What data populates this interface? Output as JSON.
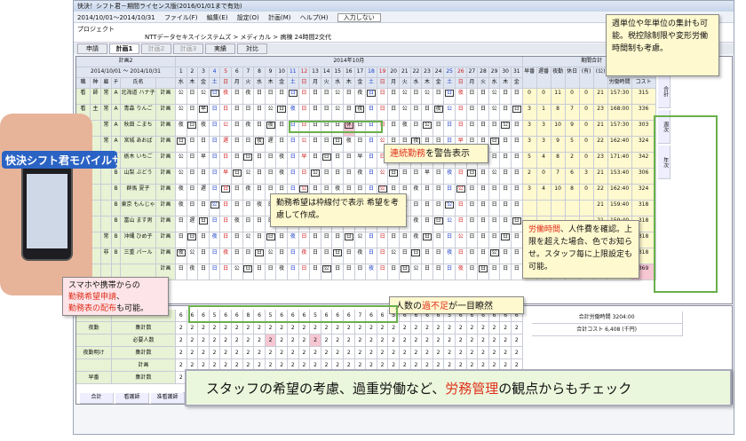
{
  "window": {
    "title": "快決！シフト君－期間ライセンス版(2016/01/01まで有効)",
    "period": "2014/10/01～2014/10/31",
    "menu": [
      "ファイル(F)",
      "編集(E)",
      "設定(O)",
      "計画(M)",
      "ヘルプ(H)"
    ],
    "input_placeholder": "入力しない",
    "project_label": "プロジェクト",
    "project_name": "NTTデータセキスイシステムズ > メディカル > 病棟 24時間2交代"
  },
  "tabs": [
    {
      "label": "申請"
    },
    {
      "label": "計画1"
    },
    {
      "label": "計画2"
    },
    {
      "label": "計画3"
    },
    {
      "label": "実績"
    },
    {
      "label": "対比"
    }
  ],
  "grid": {
    "plan_label": "計画2",
    "range": "2014/10/01 ～ 2014/10/31",
    "month": "2014年10月",
    "period_total": "期間合計",
    "head_cols": [
      "職",
      "种",
      "雇",
      "チ",
      "氏名"
    ],
    "days": [
      "1",
      "2",
      "3",
      "4",
      "5",
      "6",
      "7",
      "8",
      "9",
      "10",
      "11",
      "12",
      "13",
      "14",
      "15",
      "16",
      "17",
      "18",
      "19",
      "20",
      "21",
      "22",
      "23",
      "24",
      "25",
      "26",
      "27",
      "28",
      "29",
      "30",
      "31"
    ],
    "weekdays": [
      "水",
      "木",
      "金",
      "土",
      "日",
      "月",
      "火",
      "水",
      "木",
      "金",
      "土",
      "日",
      "月",
      "火",
      "水",
      "木",
      "金",
      "土",
      "日",
      "月",
      "火",
      "水",
      "木",
      "金",
      "土",
      "日",
      "月",
      "火",
      "水",
      "木",
      "金"
    ],
    "sum_headers": [
      "早番",
      "遅番",
      "夜勤",
      "休日",
      "(有)",
      "(公)"
    ],
    "total_headers": [
      "合計",
      "労働時間",
      "コスト"
    ],
    "side_tabs": [
      "合計",
      "週次",
      "年次"
    ],
    "staff": [
      {
        "role": "看",
        "type": "師",
        "emp": "常",
        "team": "A",
        "name": "北海道 ハナ子",
        "plan": "計画",
        "sums": [
          "0",
          "0",
          "11",
          "0",
          "0",
          "21"
        ],
        "hours": "157:30",
        "cost": "315"
      },
      {
        "role": "看",
        "type": "主",
        "emp": "常",
        "team": "A",
        "name": "青森 りんご",
        "plan": "計画",
        "sums": [
          "3",
          "1",
          "8",
          "7",
          "0",
          "23"
        ],
        "hours": "168:00",
        "cost": "336"
      },
      {
        "role": "看",
        "type": "",
        "emp": "常",
        "team": "A",
        "name": "秋田 こまち",
        "plan": "計画",
        "sums": [
          "3",
          "3",
          "10",
          "9",
          "0",
          "21"
        ],
        "hours": "157:30",
        "cost": "303"
      },
      {
        "role": "看",
        "type": "",
        "emp": "常",
        "team": "A",
        "name": "宮城 あおば",
        "plan": "計画",
        "sums": [
          "3",
          "3",
          "9",
          "5",
          "0",
          "22"
        ],
        "hours": "162:40",
        "cost": "324"
      },
      {
        "role": "",
        "type": "",
        "emp": "",
        "team": "A",
        "name": "栃木 いちご",
        "plan": "計画",
        "sums": [
          "5",
          "4",
          "8",
          "2",
          "0",
          "23"
        ],
        "hours": "171:40",
        "cost": "342"
      },
      {
        "role": "",
        "type": "",
        "emp": "",
        "team": "B",
        "name": "山梨 ぶどう",
        "plan": "計画",
        "sums": [
          "2",
          "0",
          "7",
          "6",
          "3",
          "21"
        ],
        "hours": "153:40",
        "cost": "306"
      },
      {
        "role": "",
        "type": "",
        "emp": "",
        "team": "B",
        "name": "群馬 夏子",
        "plan": "計画",
        "sums": [
          "3",
          "4",
          "10",
          "8",
          "0",
          "22"
        ],
        "hours": "162:40",
        "cost": "324"
      },
      {
        "role": "",
        "type": "",
        "emp": "",
        "team": "B",
        "name": "東京 もんじゃ",
        "plan": "計画",
        "sums": [
          "",
          "",
          "",
          "",
          "",
          "21"
        ],
        "hours": "159:40",
        "cost": "318"
      },
      {
        "role": "",
        "type": "",
        "emp": "",
        "team": "B",
        "name": "富山 ます男",
        "plan": "計画",
        "sums": [
          "",
          "",
          "",
          "",
          "",
          "21"
        ],
        "hours": "159:40",
        "cost": "318"
      },
      {
        "role": "",
        "type": "",
        "emp": "常",
        "team": "B",
        "name": "沖縄 ひめ子",
        "plan": "計画",
        "sums": [
          "",
          "",
          "",
          "",
          "",
          "21"
        ],
        "hours": "159:40",
        "cost": "318"
      },
      {
        "role": "",
        "type": "",
        "emp": "非",
        "team": "B",
        "name": "三重 パール",
        "plan": "計画",
        "sums": [
          "",
          "",
          "",
          "",
          "",
          "21"
        ],
        "hours": "159:40",
        "cost": "318"
      },
      {
        "role": "",
        "type": "",
        "emp": "",
        "team": "",
        "name": "",
        "plan": "計画",
        "sums": [
          "",
          "",
          "",
          "",
          "",
          "16"
        ],
        "hours": "124:00",
        "cost": "369"
      }
    ],
    "rows_codes": [
      "公日公日夜日夜日日日日日日日公日夜日日日公日公日日夜日日公日日",
      "公日早日日日日日公日夜日日日公日夜日日日公日日夜公日日日公日日",
      "夜日夜日公日夜日夜日日日日日日休日日日日夜日公日日日日日日公日",
      "日日日日遅日日夜遅日日公日日日夜日日公日日夜日日日早日日日日日",
      "公日早日日日日日日夜日早日日日日早日日日夜日早日日日日早日日日",
      "公日日日早日公日日夜日日公日日日夜日公日日日早日夜日日日公日日",
      "夜日遅日日日夜日日日日公日日夜日日日公日日夜日日日公日日日日日",
      "夜日日公日日日夜日日日公日日夜日日公日日夜日日日公日日日日日日",
      "日遅日日日夜日日日公日日夜日日日早日日日日夜日日公日日日日日日",
      "日日日夜日日公日日日夜日日日日日公日日日日夜日日日公日日日日日",
      "夜公日日夜日日日公日日夜日日日日夜日日公日日日日夜日日日公日日",
      "日夜日日日公日日日夜日日日公日日日夜日日日公日日日夜日日日日日"
    ]
  },
  "lower": {
    "rows": [
      {
        "label": "",
        "sub": "",
        "vals": [
          "6",
          "6",
          "6",
          "5",
          "6",
          "6",
          "8",
          "6",
          "5",
          "6",
          "6",
          "6",
          "5",
          "6",
          "6",
          "6",
          "7",
          "6",
          "6",
          "5",
          "6",
          "6",
          "6",
          "6",
          "5",
          "6",
          "6",
          "6",
          "6",
          "6",
          "6"
        ]
      },
      {
        "label": "夜勤",
        "sub": "集計数",
        "vals": [
          "2",
          "2",
          "2",
          "2",
          "2",
          "2",
          "2",
          "2",
          "2",
          "2",
          "2",
          "2",
          "2",
          "2",
          "2",
          "2",
          "2",
          "2",
          "2",
          "2",
          "2",
          "2",
          "2",
          "2",
          "2",
          "2",
          "2",
          "2",
          "2",
          "2",
          "2"
        ]
      },
      {
        "label": "",
        "sub": "必要人数",
        "vals": [
          "2",
          "2",
          "2",
          "2",
          "2",
          "2",
          "2",
          "2",
          "2",
          "2",
          "2",
          "2",
          "2",
          "2",
          "2",
          "2",
          "2",
          "2",
          "2",
          "2",
          "2",
          "2",
          "2",
          "2",
          "2",
          "2",
          "2",
          "2",
          "2",
          "2",
          "2"
        ]
      },
      {
        "label": "夜勤明け",
        "sub": "集計数",
        "vals": [
          "2",
          "2",
          "2",
          "2",
          "2",
          "2",
          "2",
          "2",
          "2",
          "2",
          "2",
          "2",
          "2",
          "2",
          "2",
          "2",
          "2",
          "2",
          "2",
          "2",
          "2",
          "2",
          "2",
          "2",
          "2",
          "2",
          "2",
          "2",
          "2",
          "2",
          "2"
        ]
      },
      {
        "label": "",
        "sub": "計画",
        "vals": [
          "2",
          "2",
          "2",
          "2",
          "2",
          "2",
          "2",
          "2",
          "2",
          "2",
          "2",
          "2",
          "2",
          "2",
          "2",
          "2",
          "2",
          "2",
          "2",
          "2",
          "2",
          "2",
          "2",
          "2",
          "2",
          "2",
          "2",
          "2",
          "2",
          "2",
          "2"
        ]
      },
      {
        "label": "早番",
        "sub": "集計数",
        "vals": [
          "2",
          "2",
          "2",
          "2",
          "2",
          "2",
          "2",
          "2",
          "2",
          "2",
          "2",
          "2",
          "2",
          "2",
          "2",
          "2",
          "2",
          "2",
          "2",
          "2",
          "2",
          "2",
          "2",
          "2",
          "2",
          "2",
          "2",
          "2",
          "2",
          "2",
          "2"
        ]
      }
    ],
    "total_hours_label": "合計労働時間",
    "total_hours": "3204:00",
    "total_cost_label": "合計コスト",
    "total_cost": "6,408 (千円)",
    "bottom_tabs": [
      "合計",
      "看護師",
      "准看護師"
    ],
    "bottom_label_required": "必要人数",
    "bottom_label_plan": "計画"
  },
  "callouts": {
    "top_right": "週単位や年単位の集計も可能。税控除制限や変形労働時間制も考慮。",
    "consecutive_a": "連続勤務",
    "consecutive_b": "を警告表示",
    "request": "勤務希望は枠線付で表示 希望を考慮して作成。",
    "labor_a": "労働時間",
    "labor_b": "、人件費を確認。上限を超えた場合、色でお知らせ。スタッフ毎に上限設定も可能。",
    "short_a": "人数の",
    "short_b": "過不足",
    "short_c": "が一目瞭然",
    "phone_a": "スマホや携帯からの",
    "phone_b": "勤務希望申請",
    "phone_c": "、",
    "phone_d": "勤務表の配布",
    "phone_e": "も可能。",
    "bottom_a": "スタッフの希望の考慮、過重労働など、",
    "bottom_b": "労務管理",
    "bottom_c": "の観点からもチェック",
    "logo": "快決シフト君モバイルサービス"
  }
}
